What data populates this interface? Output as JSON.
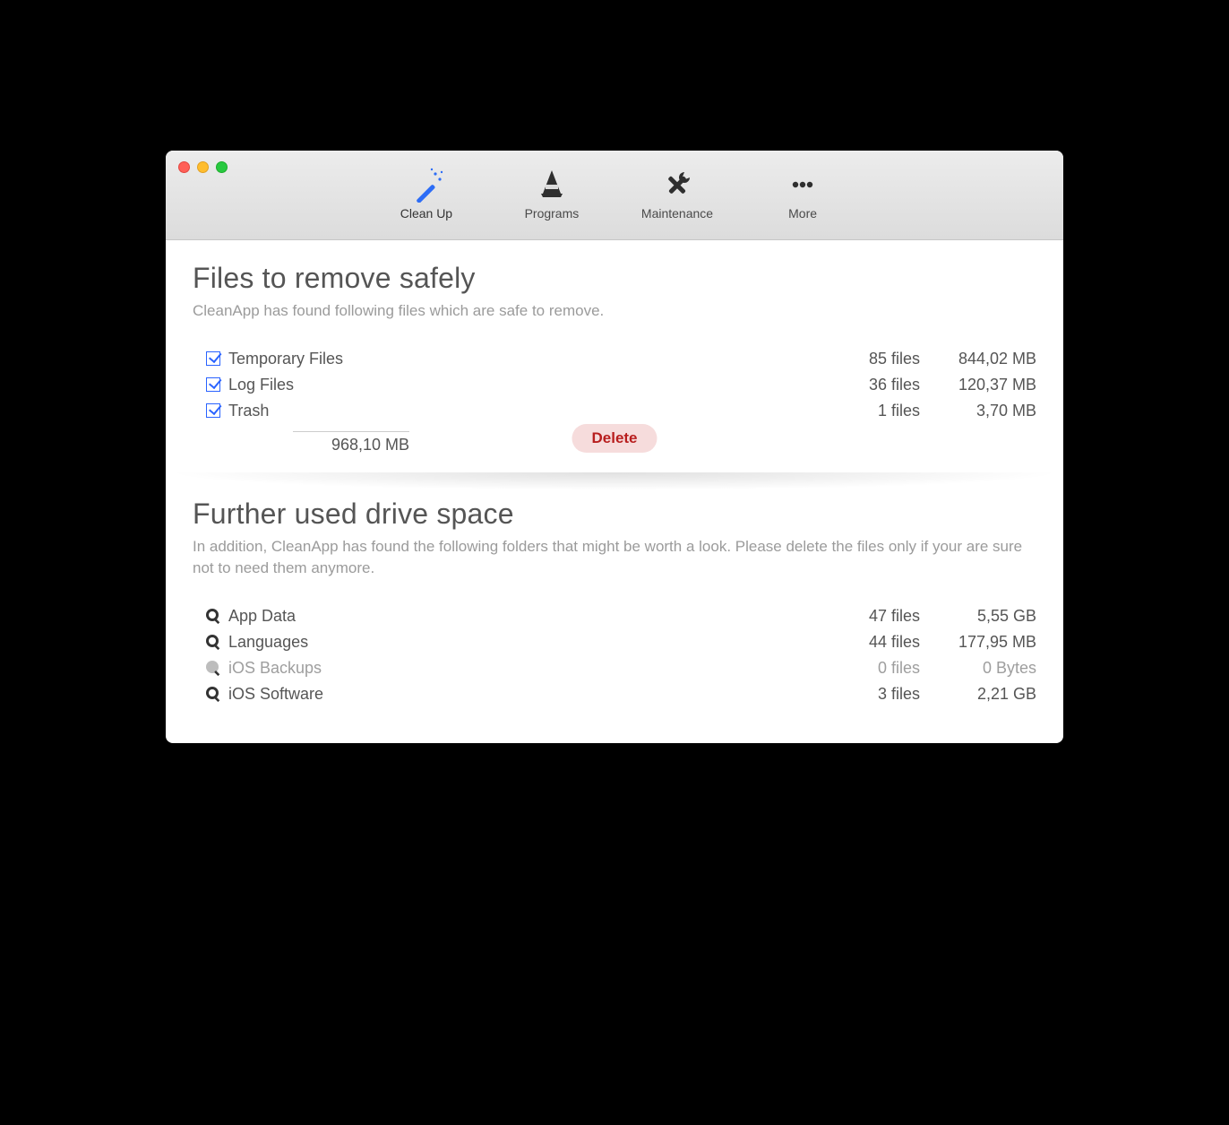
{
  "toolbar": {
    "items": [
      {
        "label": "Clean Up",
        "active": true
      },
      {
        "label": "Programs",
        "active": false
      },
      {
        "label": "Maintenance",
        "active": false
      },
      {
        "label": "More",
        "active": false
      }
    ]
  },
  "section1": {
    "title": "Files to remove safely",
    "subtitle": "CleanApp has found following files which are safe to remove.",
    "rows": [
      {
        "label": "Temporary Files",
        "files": "85 files",
        "size": "844,02 MB",
        "checked": true
      },
      {
        "label": "Log Files",
        "files": "36 files",
        "size": "120,37 MB",
        "checked": true
      },
      {
        "label": "Trash",
        "files": "1 files",
        "size": "3,70 MB",
        "checked": true
      }
    ],
    "delete_label": "Delete",
    "total_size": "968,10 MB"
  },
  "section2": {
    "title": "Further used drive space",
    "subtitle": "In addition, CleanApp has found the following folders that might be worth a look. Please delete the files only if your are sure not to need them anymore.",
    "rows": [
      {
        "label": "App Data",
        "files": "47 files",
        "size": "5,55 GB",
        "dim": false
      },
      {
        "label": "Languages",
        "files": "44 files",
        "size": "177,95 MB",
        "dim": false
      },
      {
        "label": "iOS Backups",
        "files": "0 files",
        "size": "0 Bytes",
        "dim": true
      },
      {
        "label": "iOS Software",
        "files": "3 files",
        "size": "2,21 GB",
        "dim": false
      }
    ]
  }
}
